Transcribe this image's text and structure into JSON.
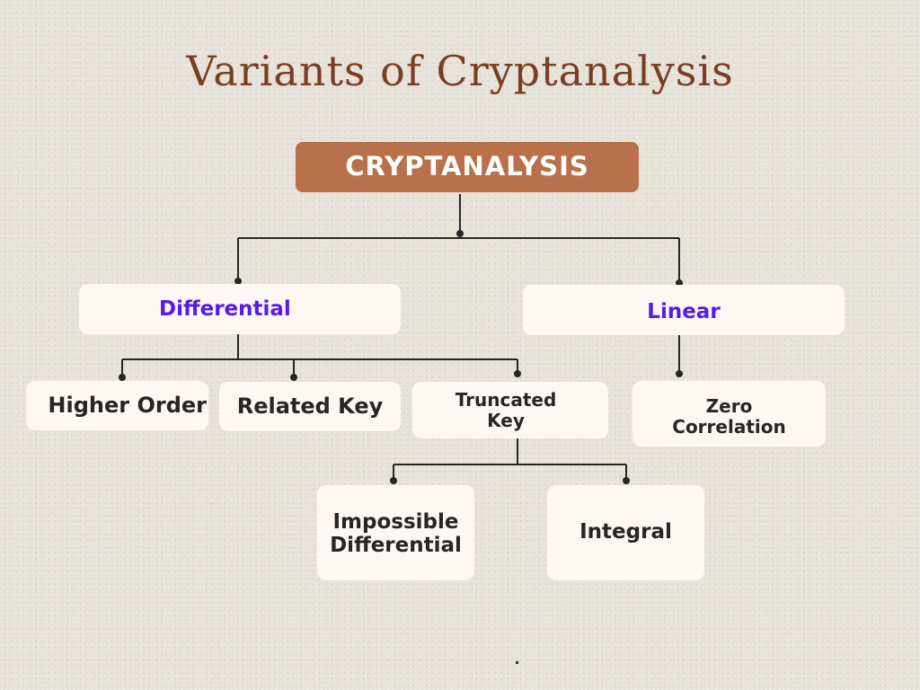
{
  "title": "Variants of Cryptanalysis",
  "colors": {
    "root_fill": "#b9714c",
    "category_text": "#5a1ae6",
    "node_fill": "#fdf8f3",
    "title_text": "#7a3e22",
    "connector": "#262626"
  },
  "tree": {
    "root": {
      "label": "CRYPTANALYSIS"
    },
    "categories": [
      {
        "label": "Differential",
        "children": [
          {
            "label": "Higher Order"
          },
          {
            "label": "Related Key"
          },
          {
            "label": "Truncated\nKey",
            "children": [
              {
                "label": "Impossible\nDifferential"
              },
              {
                "label": "Integral"
              }
            ]
          }
        ]
      },
      {
        "label": "Linear",
        "children": [
          {
            "label": "Zero\nCorrelation"
          }
        ]
      }
    ]
  }
}
